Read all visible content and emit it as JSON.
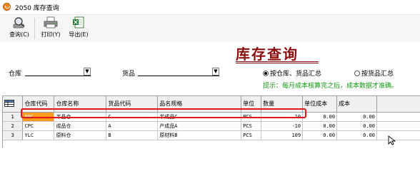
{
  "window": {
    "title": "2050 库存查询"
  },
  "toolbar": {
    "query_label": "查询(C)",
    "print_label": "打印(Y)",
    "export_label": "导出(E)"
  },
  "page_title": "库存查询",
  "filters": {
    "warehouse_label": "仓库",
    "warehouse_value": "",
    "goods_label": "货品",
    "goods_value": ""
  },
  "options": {
    "by_wh_goods": "按仓库、货品汇总",
    "by_goods": "按货品汇总",
    "selected": "by_wh_goods"
  },
  "hint": "提示：每月成本核算完之后，成本数据才准确。",
  "table": {
    "headers": {
      "code": "仓库代码",
      "name": "仓库名称",
      "gcode": "货品代码",
      "spec": "品名规格",
      "unit": "单位",
      "qty": "数量",
      "ucost": "单位成本",
      "cost": "成本"
    },
    "rows": [
      {
        "num": "1",
        "code": "BPC",
        "name": "半品仓",
        "gcode": "C",
        "spec": "半成品C",
        "unit": "PCS",
        "qty": "10",
        "ucost": "0.00",
        "cost": "0.00"
      },
      {
        "num": "2",
        "code": "CPC",
        "name": "成品仓",
        "gcode": "A",
        "spec": "产成品A",
        "unit": "PCS",
        "qty": "-10",
        "ucost": "0.00",
        "cost": "0.00"
      },
      {
        "num": "3",
        "code": "YLC",
        "name": "原料仓",
        "gcode": "B",
        "spec": "原材料B",
        "unit": "PCS",
        "qty": "109",
        "ucost": "0.00",
        "cost": "0.00"
      }
    ]
  },
  "colors": {
    "title": "#8b0d0d",
    "hint": "#109c10",
    "selected_cell": "#ff9b1e",
    "highlight_box": "#e01818"
  }
}
